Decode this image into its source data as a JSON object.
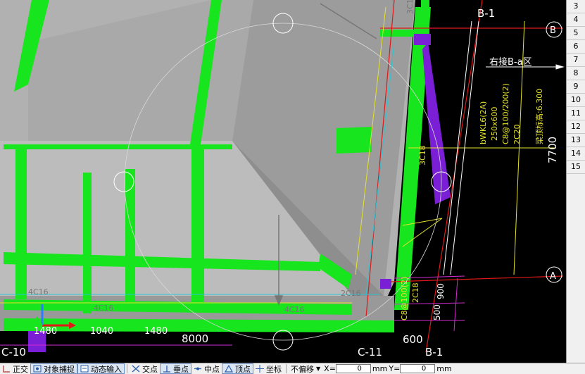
{
  "window": {
    "title": ""
  },
  "axes": {
    "b1_top": "B-1",
    "b1_bottom": "B-1",
    "b_bubble": "B",
    "a_bubble": "A",
    "c11": "C-11",
    "c10": "C-10"
  },
  "annotations": {
    "right_connect": "右接B-a区",
    "dim_7700": "7700",
    "dim_8000": "8000",
    "dim_600": "600",
    "dim_1480_a": "1480",
    "dim_1040": "1040",
    "dim_1480_b": "1480",
    "dim_900": "900",
    "dim_500": "500",
    "beam_line1": "bWKL6(2A)",
    "beam_line2": "250x600",
    "beam_line3": "C8@100/200(2)",
    "beam_line4": "2C20",
    "beam_elev": "梁顶标高:6.300",
    "rebar_3c18_top": "3C18",
    "rebar_3c18_mid": "3C18",
    "rebar_2c18": "2C18",
    "rebar_stirrup": "C8@100(2)",
    "rebar_4c16_a": "4C16",
    "rebar_4c16_b": "4C16",
    "rebar_4c16_c": "4C16",
    "rebar_2c16": "2C16"
  },
  "row_numbers": [
    "3",
    "4",
    "5",
    "6",
    "7",
    "8",
    "9",
    "10",
    "11",
    "12",
    "13",
    "14",
    "15"
  ],
  "statusbar": {
    "ortho_label": "正交",
    "snap_label": "对象捕捉",
    "dyn_label": "动态输入",
    "intersect_label": "交点",
    "perp_label": "垂点",
    "mid_label": "中点",
    "vertex_label": "顶点",
    "coord_label": "坐标",
    "offset_select": "不偏移",
    "x_label": "X=",
    "x_value": "0",
    "x_unit": "mm",
    "y_label": "Y=",
    "y_value": "0",
    "y_unit": "mm"
  },
  "colors": {
    "background": "#000000",
    "beam_green": "#17e51d",
    "concrete_gray": "#b4b4b4",
    "accent_purple": "#7a1fd6",
    "cad_yellow": "#e6e22b",
    "axis_red": "#e01818",
    "dim_magenta": "#d42bd4",
    "bubble_white": "#ffffff"
  }
}
